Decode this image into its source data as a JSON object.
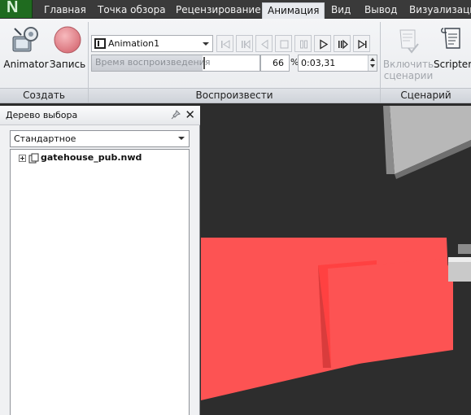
{
  "app": {
    "logo_letter": "N"
  },
  "tabs": [
    {
      "label": "Главная",
      "active": false
    },
    {
      "label": "Точка обзора",
      "active": false
    },
    {
      "label": "Рецензирование",
      "active": false
    },
    {
      "label": "Анимация",
      "active": true
    },
    {
      "label": "Вид",
      "active": false
    },
    {
      "label": "Вывод",
      "active": false
    },
    {
      "label": "Визуализация",
      "active": false
    }
  ],
  "ribbon": {
    "create": {
      "group_label": "Создать",
      "animator_label": "Animator",
      "record_label": "Запись",
      "animator_icon": "animator-icon",
      "record_icon": "record-icon"
    },
    "playback": {
      "group_label": "Воспроизвести",
      "animation_select_value": "Animation1",
      "time_slider_label": "Время воспроизведения",
      "time_slider_fraction": 0.66,
      "percent_value": "66",
      "percent_sign": "%",
      "timecode": "0:03,31",
      "controls": [
        "rewind-to-start-icon",
        "step-back-icon",
        "play-reverse-icon",
        "stop-icon",
        "pause-icon",
        "play-icon",
        "step-forward-icon",
        "fast-forward-to-end-icon"
      ]
    },
    "scripts": {
      "group_label": "Сценарий",
      "enable_scripts_line1": "Включить",
      "enable_scripts_line2": "сценарии",
      "scripter_label": "Scripter",
      "enable_scripts_enabled": false
    }
  },
  "selection_tree": {
    "title": "Дерево выбора",
    "mode_value": "Стандартное",
    "items": [
      {
        "label": "gatehouse_pub.nwd"
      }
    ]
  },
  "colors": {
    "highlight_red": "#fd5353",
    "viewport_bg": "#2d2d2d",
    "active_tab": "#e8eaee"
  }
}
